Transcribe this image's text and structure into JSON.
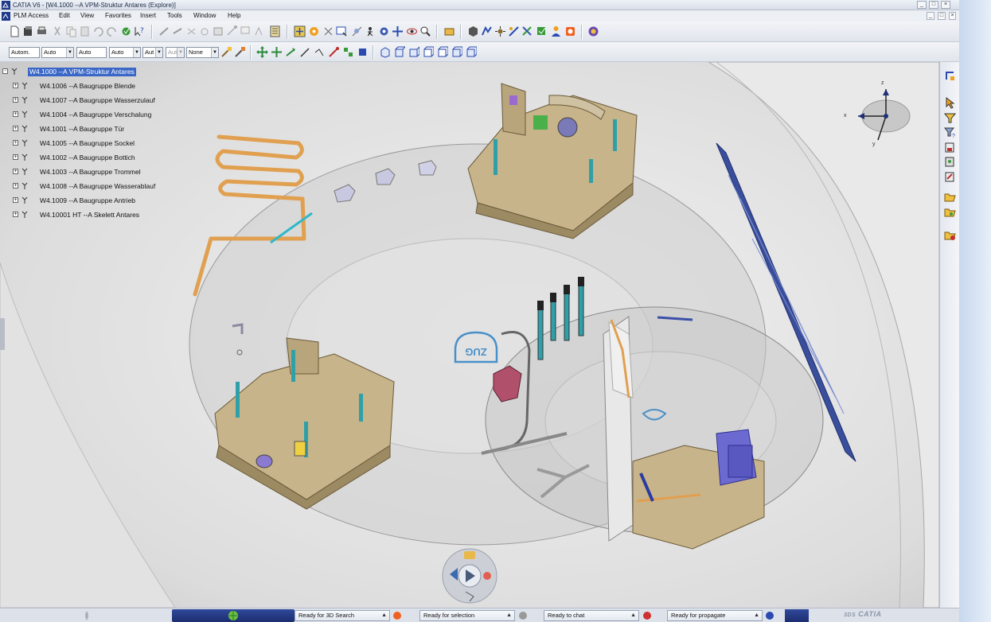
{
  "window": {
    "title": "CATIA V6 - [W4.1000 --A VPM-Struktur Antares (Explore)]",
    "logo": "catia-logo-icon",
    "controls": [
      "_",
      "□",
      "×"
    ]
  },
  "menubar": {
    "items": [
      {
        "label": "PLM Access",
        "accel": "P"
      },
      {
        "label": "Edit",
        "accel": "E"
      },
      {
        "label": "View",
        "accel": "V"
      },
      {
        "label": "Favorites",
        "accel": "a"
      },
      {
        "label": "Insert",
        "accel": "I"
      },
      {
        "label": "Tools",
        "accel": "T"
      },
      {
        "label": "Window",
        "accel": "W"
      },
      {
        "label": "Help",
        "accel": "H"
      }
    ],
    "mdi_controls": [
      "_",
      "□",
      "×"
    ]
  },
  "toolbar2": {
    "combos": [
      {
        "value": "Autom."
      },
      {
        "value": "Auto"
      },
      {
        "value": "Auto"
      },
      {
        "value": "Auto"
      },
      {
        "value": "Aut"
      },
      {
        "value": "Aut",
        "disabled": true
      },
      {
        "value": "None"
      }
    ]
  },
  "tree": {
    "root": "W4.1000 --A VPM-Struktur Antares",
    "items": [
      "W4.1006 --A Baugruppe Blende",
      "W4.1007 --A Baugruppe Wasserzulauf",
      "W4.1004 --A Baugruppe Verschalung",
      "W4.1001 --A Baugruppe Tür",
      "W4.1005 --A Baugruppe Sockel",
      "W4.1002 --A Baugruppe Bottich",
      "W4.1003 --A Baugruppe Trommel",
      "W4.1008 --A Baugruppe Wasserablauf",
      "W4.1009 --A Baugruppe Antrieb",
      "W4.10001 HT --A Skelett Antares"
    ]
  },
  "compass": {
    "x_label": "x",
    "y_label": "y",
    "z_label": "z"
  },
  "scene": {
    "logo_text": "ZUG"
  },
  "statusbar": {
    "tasks": [
      {
        "label": "Ready for 3D Search"
      },
      {
        "label": "Ready for selection"
      },
      {
        "label": "Ready to chat"
      },
      {
        "label": "Ready for propagate"
      }
    ],
    "brand": "CATIA",
    "brand_prefix": "3DS"
  },
  "colors": {
    "selection": "#3a67c7",
    "part_tan": "#c8b48a",
    "tube_orange": "#e0a050",
    "accent_blue": "#2a3d8f"
  }
}
